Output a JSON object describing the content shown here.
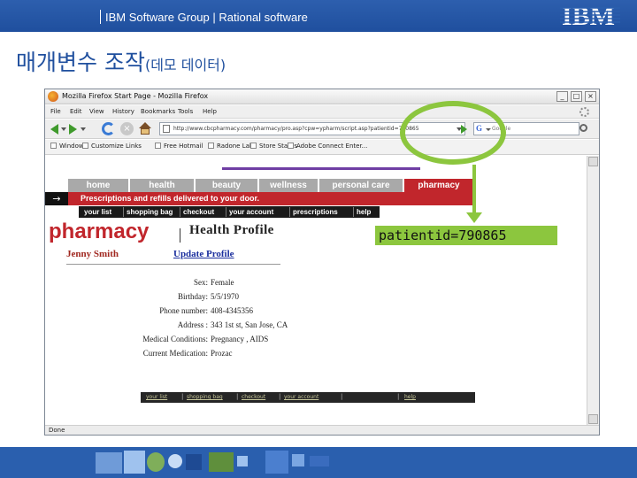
{
  "header": {
    "text": "IBM Software Group | Rational software",
    "logo_text": "IBM"
  },
  "slide": {
    "title": "매개변수 조작",
    "title_small": "(데모 데이터)"
  },
  "browser": {
    "window_title": "Mozilla Firefox Start Page - Mozilla Firefox",
    "menu": [
      "File",
      "Edit",
      "View",
      "History",
      "Bookmarks",
      "Tools",
      "Help"
    ],
    "url": "http://www.cbcpharmacy.com/pharmacy/pro.asp?cpw=ypharm/script.asp?patientid=790865",
    "search_placeholder": "Google",
    "bookmarks": [
      "Windows",
      "Customize Links",
      "Free Hotmail",
      "Radone Lab",
      "Store Status",
      "Adobe Connect Enter..."
    ],
    "status": "Done",
    "controls": {
      "minimize": "_",
      "maximize": "□",
      "close": "×"
    }
  },
  "page": {
    "tabs": [
      "home",
      "health",
      "beauty",
      "wellness",
      "personal care",
      "pharmacy"
    ],
    "banner": "Prescriptions and refills delivered to your door.",
    "banner_arrow": "→",
    "subnav": [
      "your list",
      "shopping bag",
      "checkout",
      "your account",
      "prescriptions",
      "help"
    ],
    "logo": "pharmacy",
    "profile_title": "Health Profile",
    "user_name": "Jenny Smith",
    "update_link": "Update Profile",
    "fields": [
      {
        "label": "Sex:",
        "value": "Female"
      },
      {
        "label": "Birthday:",
        "value": "5/5/1970"
      },
      {
        "label": "Phone number:",
        "value": "408-4345356"
      },
      {
        "label": "Address :",
        "value": "343 1st st, San Jose, CA"
      },
      {
        "label": "Medical Conditions:",
        "value": "Pregnancy , AIDS"
      },
      {
        "label": "Current Medication:",
        "value": "Prozac"
      }
    ],
    "footer_links": [
      "your list",
      "shopping bag",
      "checkout",
      "your account",
      "help"
    ]
  },
  "annotation": {
    "callout": "patientid=790865",
    "color": "#8cc63e"
  },
  "colors": {
    "header_blue": "#1f4f9e",
    "pharmacy_red": "#c1262c",
    "annotation_green": "#8cc63e"
  }
}
